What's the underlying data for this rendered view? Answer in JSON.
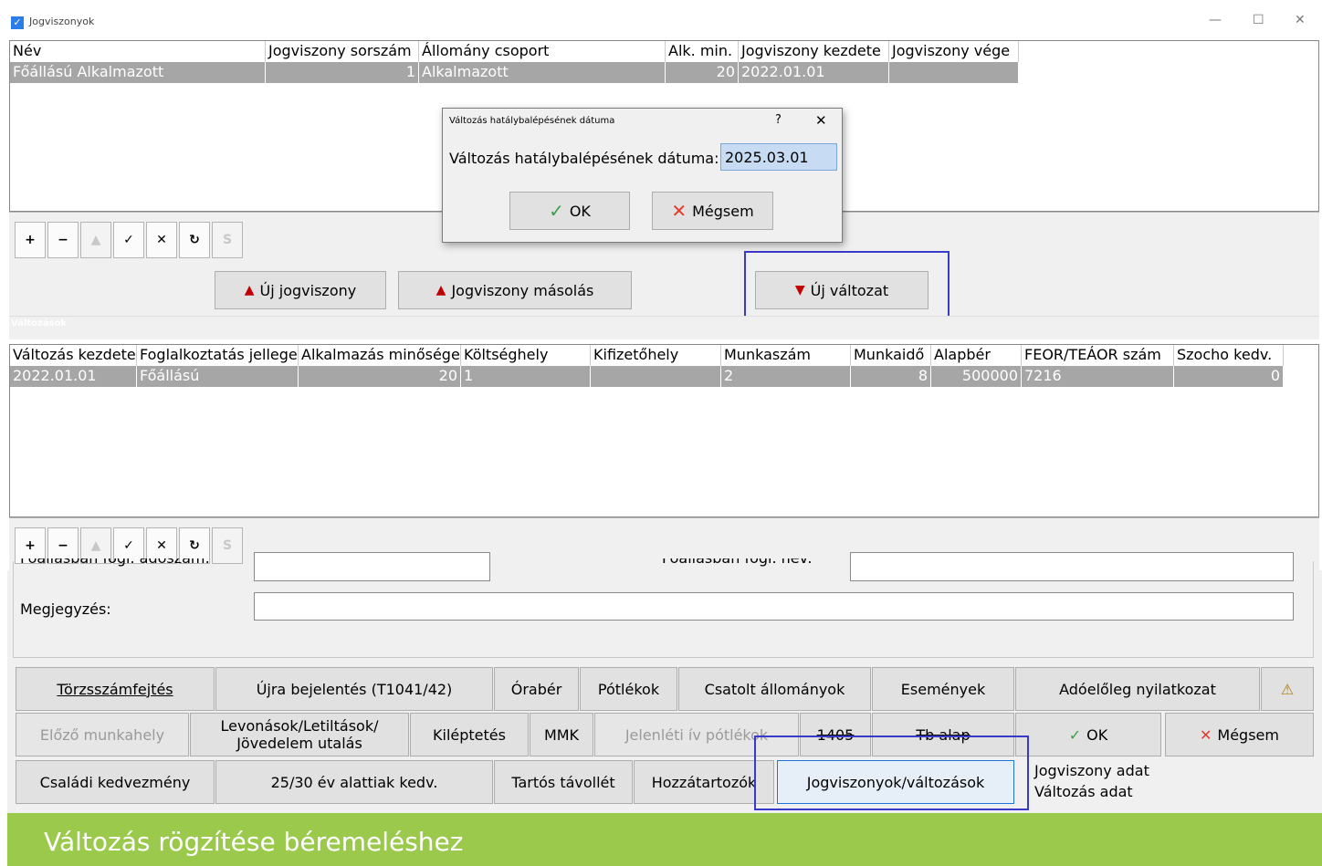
{
  "window": {
    "title": "Jogviszonyok",
    "minimize": "—",
    "maximize": "☐",
    "close": "✕"
  },
  "grid1": {
    "headers": [
      "Név",
      "Jogviszony sorszám",
      "Állomány csoport",
      "Alk. min.",
      "Jogviszony kezdete",
      "Jogviszony vége"
    ],
    "row": [
      "Főállású Alkalmazott",
      "1",
      "Alkalmazott",
      "20",
      "2022.01.01",
      ""
    ]
  },
  "toolbar": {
    "add": "+",
    "remove": "−",
    "up": "▲",
    "confirm": "✓",
    "cancel": "✕",
    "refresh": "↻",
    "s": "S"
  },
  "actions": {
    "new_relation": "Új jogviszony",
    "copy_relation": "Jogviszony másolás",
    "new_change": "Új változat"
  },
  "section_label": "Változások",
  "grid2": {
    "headers": [
      "Változás kezdete",
      "Foglalkoztatás jellege",
      "Alkalmazás minősége",
      "Költséghely",
      "Kifizetőhely",
      "Munkaszám",
      "Munkaidő",
      "Alapbér",
      "FEOR/TEÁOR szám",
      "Szocho kedv."
    ],
    "row": [
      "2022.01.01",
      "Főállású",
      "20",
      "1",
      "",
      "2",
      "8",
      "500000",
      "7216",
      "0"
    ]
  },
  "dialog": {
    "title": "Változás hatálybalépésének dátuma",
    "help": "?",
    "close": "✕",
    "label": "Változás hatálybalépésének dátuma:",
    "value": "2025.03.01",
    "ok": "OK",
    "cancel": "Mégsem"
  },
  "form": {
    "tax_label": "Főállásban fogl. adószám:",
    "name_label": "Főállásban fogl. név:",
    "note_label": "Megjegyzés:"
  },
  "buttons_row1": [
    "Törzsszámfejtés",
    "Újra bejelentés (T1041/42)",
    "Órabér",
    "Pótlékok",
    "Csatolt állományok",
    "Események",
    "Adóelőleg nyilatkozat"
  ],
  "buttons_row2": {
    "prev_workplace": "Előző munkahely",
    "deductions_line1": "Levonások/Letiltások/",
    "deductions_line2": "Jövedelem utalás",
    "exit": "Kiléptetés",
    "mmk": "MMK",
    "attendance": "Jelenléti ív pótlékok",
    "code_1405": "1405",
    "tb_base": "Tb alap",
    "ok": "OK",
    "cancel": "Mégsem"
  },
  "buttons_row3": {
    "family": "Családi kedvezmény",
    "under_25": "25/30 év alattiak kedv.",
    "absence": "Tartós távollét",
    "relatives": "Hozzátartozók",
    "relations": "Jogviszonyok/változások"
  },
  "legend": {
    "line1": "Jogviszony adat",
    "line2": "Változás adat"
  },
  "footer": "Változás rögzítése béremeléshez",
  "colors": {
    "row_selected": "#a6a6a6",
    "highlight": "#3a3ac8",
    "footer": "#9ac94c"
  }
}
